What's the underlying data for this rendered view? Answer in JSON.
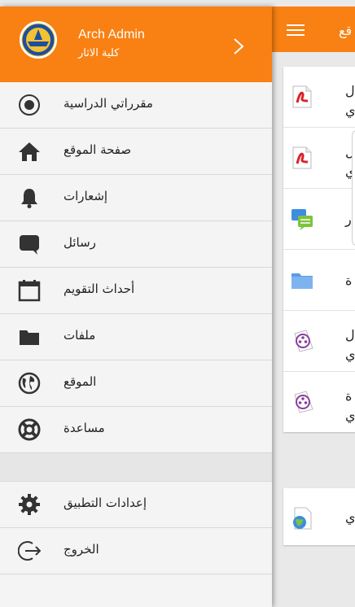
{
  "app": {
    "header_title": "قع"
  },
  "course_items": [
    {
      "icon": "pdf-icon",
      "lines": [
        "ل",
        "ي"
      ]
    },
    {
      "icon": "pdf-icon",
      "lines": [
        "ل",
        "ي"
      ]
    },
    {
      "icon": "forum-icon",
      "lines": [
        "ر"
      ]
    },
    {
      "icon": "folder-icon",
      "lines": [
        "ة"
      ]
    },
    {
      "icon": "video-icon",
      "lines": [
        "ل",
        "ي"
      ]
    },
    {
      "icon": "video-icon",
      "lines": [
        "ة",
        "ي"
      ]
    }
  ],
  "extra_item": {
    "icon": "url-icon",
    "lines": [
      "ي"
    ]
  },
  "drawer": {
    "user": {
      "name": "Arch Admin",
      "subtitle": "كلية الاثار"
    },
    "items": [
      {
        "label": "مقرراتي الدراسية",
        "icon": "target-icon"
      },
      {
        "label": "صفحة الموقع",
        "icon": "home-icon"
      },
      {
        "label": "إشعارات",
        "icon": "bell-icon"
      },
      {
        "label": "رسائل",
        "icon": "message-icon"
      },
      {
        "label": "أحداث التقويم",
        "icon": "calendar-icon"
      },
      {
        "label": "ملفات",
        "icon": "folder-icon"
      },
      {
        "label": "الموقع",
        "icon": "globe-icon"
      },
      {
        "label": "مساعدة",
        "icon": "lifebuoy-icon"
      }
    ],
    "bottom_items": [
      {
        "label": "إعدادات التطبيق",
        "icon": "gear-icon"
      },
      {
        "label": "الخروج",
        "icon": "logout-icon"
      }
    ]
  },
  "colors": {
    "accent": "#f98012",
    "drawer_bg": "#f4f4f4",
    "divider": "#d9d9d9"
  }
}
